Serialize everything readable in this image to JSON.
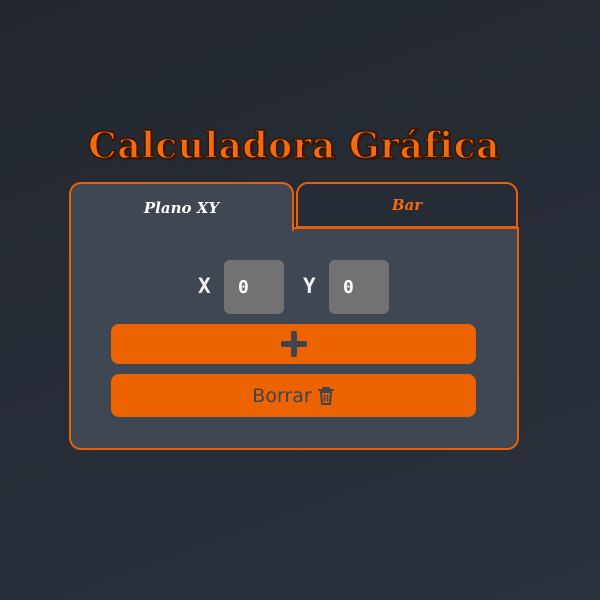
{
  "header": {
    "title": "Calculadora Gráfica"
  },
  "tabs": [
    {
      "label": "Plano XY",
      "active": true
    },
    {
      "label": "Bar",
      "active": false
    }
  ],
  "form": {
    "x_label": "X",
    "x_value": "0",
    "y_label": "Y",
    "y_value": "0"
  },
  "buttons": {
    "add_icon": "plus-icon",
    "clear_label": "Borrar",
    "clear_icon": "trash-icon"
  },
  "colors": {
    "accent": "#ec6300",
    "background": "#262c35",
    "panel": "#3f4752",
    "input": "#727272"
  }
}
